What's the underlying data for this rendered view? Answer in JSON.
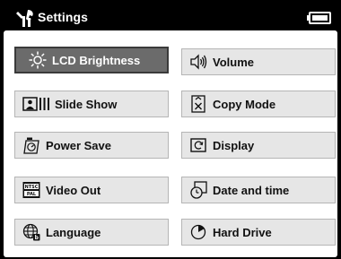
{
  "header": {
    "title": "Settings",
    "app_icon": "settings-tools-icon",
    "battery_icon": "battery-icon"
  },
  "menu": [
    {
      "label": "LCD Brightness",
      "icon": "sun-icon",
      "selected": true
    },
    {
      "label": "Volume",
      "icon": "speaker-icon",
      "selected": false
    },
    {
      "label": "Slide Show",
      "icon": "slideshow-icon",
      "selected": false
    },
    {
      "label": "Copy Mode",
      "icon": "copy-mode-icon",
      "selected": false
    },
    {
      "label": "Power Save",
      "icon": "power-save-icon",
      "selected": false
    },
    {
      "label": "Display",
      "icon": "display-icon",
      "selected": false
    },
    {
      "label": "Video Out",
      "icon": "video-out-icon",
      "icon_text": [
        "NTSC",
        "PAL"
      ],
      "selected": false
    },
    {
      "label": "Date and time",
      "icon": "clock-icon",
      "selected": false
    },
    {
      "label": "Language",
      "icon": "globe-icon",
      "selected": false
    },
    {
      "label": "Hard Drive",
      "icon": "hard-drive-icon",
      "selected": false
    }
  ],
  "colors": {
    "background": "#000000",
    "panel": "#ffffff",
    "button": "#e6e6e6",
    "selected_button": "#6b6b6b"
  }
}
